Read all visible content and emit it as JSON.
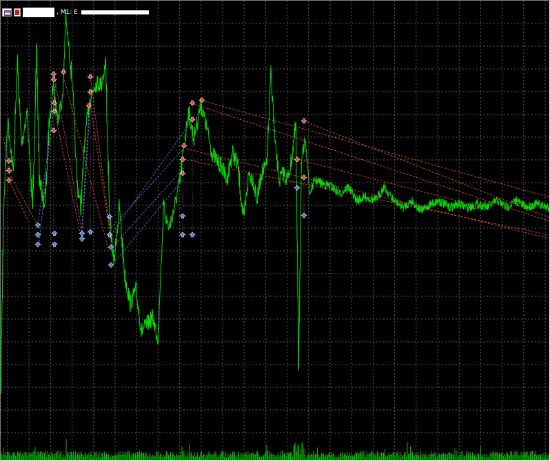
{
  "window": {
    "symbol": "",
    "timeframe_label": ", M1: E",
    "indicator_name": ""
  },
  "colors": {
    "background": "#000000",
    "grid": "#606060",
    "price": "#00e000",
    "volume": "#00c000",
    "buy_arrow": "#3c78dc",
    "sell_arrow": "#e04030",
    "trend_red": "#e05030",
    "trend_blue": "#4080e0"
  },
  "icons": [
    "table-icon",
    "document-icon"
  ],
  "chart_data": {
    "type": "line",
    "grid": true,
    "series": [
      {}
    ]
  }
}
